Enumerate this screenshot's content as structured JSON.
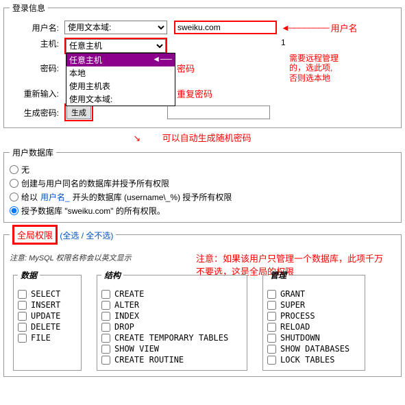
{
  "login": {
    "legend": "登录信息",
    "username_label": "用户名:",
    "username_select": "使用文本域:",
    "username_value": "sweiku.com",
    "host_label": "主机:",
    "host_select": "任意主机",
    "host_options": [
      "任意主机",
      "本地",
      "使用主机表",
      "使用文本域:"
    ],
    "host_footnote": "1",
    "password_label": "密码:",
    "password_helper": "密码",
    "retype_label": "重新输入:",
    "retype_helper": "重复密码",
    "gen_label": "生成密码:",
    "gen_btn": "生成"
  },
  "annotations": {
    "username": "用户名",
    "host_note1": "需要远程管理",
    "host_note2": "的，选此项,",
    "host_note3": "否则选本地",
    "gen_note": "可以自动生成随机密码",
    "global_note": "注意：如果该用户只管理一个数据库，此项千万不要选，这是全局的权限"
  },
  "db": {
    "legend": "用户数据库",
    "r1": "无",
    "r2": "创建与用户同名的数据库并授予所有权限",
    "r3_a": "给以",
    "r3_b": "用户名_",
    "r3_c": "开头的数据库 (username\\_%) 授予所有权限",
    "r4": "授予数据库 \"sweiku.com\" 的所有权限。"
  },
  "global": {
    "title": "全局权限",
    "check_all": "全选",
    "uncheck_all": "全不选",
    "sep": " / ",
    "paren_open": " (",
    "paren_close": ")",
    "note": "注意: MySQL 权限名称会以英文显示",
    "data_title": "数据",
    "data": [
      "SELECT",
      "INSERT",
      "UPDATE",
      "DELETE",
      "FILE"
    ],
    "struct_title": "结构",
    "struct": [
      "CREATE",
      "ALTER",
      "INDEX",
      "DROP",
      "CREATE TEMPORARY TABLES",
      "SHOW VIEW",
      "CREATE ROUTINE"
    ],
    "admin_title": "管理",
    "admin": [
      "GRANT",
      "SUPER",
      "PROCESS",
      "RELOAD",
      "SHUTDOWN",
      "SHOW DATABASES",
      "LOCK TABLES"
    ]
  }
}
